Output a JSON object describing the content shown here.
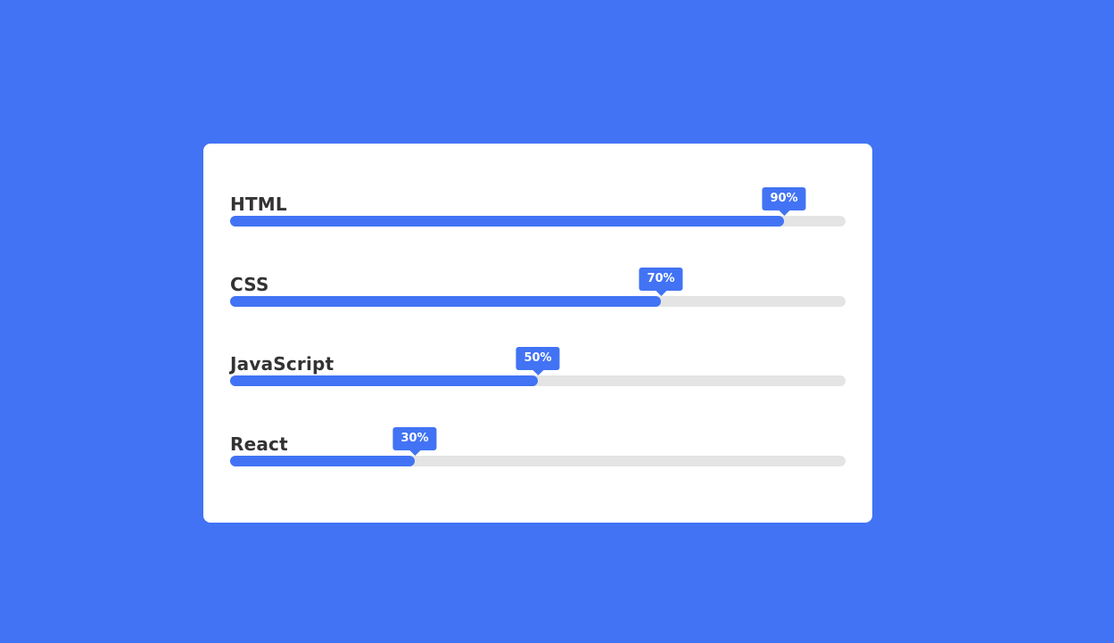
{
  "colors": {
    "background": "#4173f4",
    "card": "#ffffff",
    "accent": "#4173f4",
    "track": "#e4e4e4",
    "label_text": "#333333"
  },
  "skills": [
    {
      "label": "HTML",
      "percent_label": "90%",
      "progress": 0.9
    },
    {
      "label": "CSS",
      "percent_label": "70%",
      "progress": 0.7
    },
    {
      "label": "JavaScript",
      "percent_label": "50%",
      "progress": 0.5
    },
    {
      "label": "React",
      "percent_label": "30%",
      "progress": 0.3
    }
  ]
}
